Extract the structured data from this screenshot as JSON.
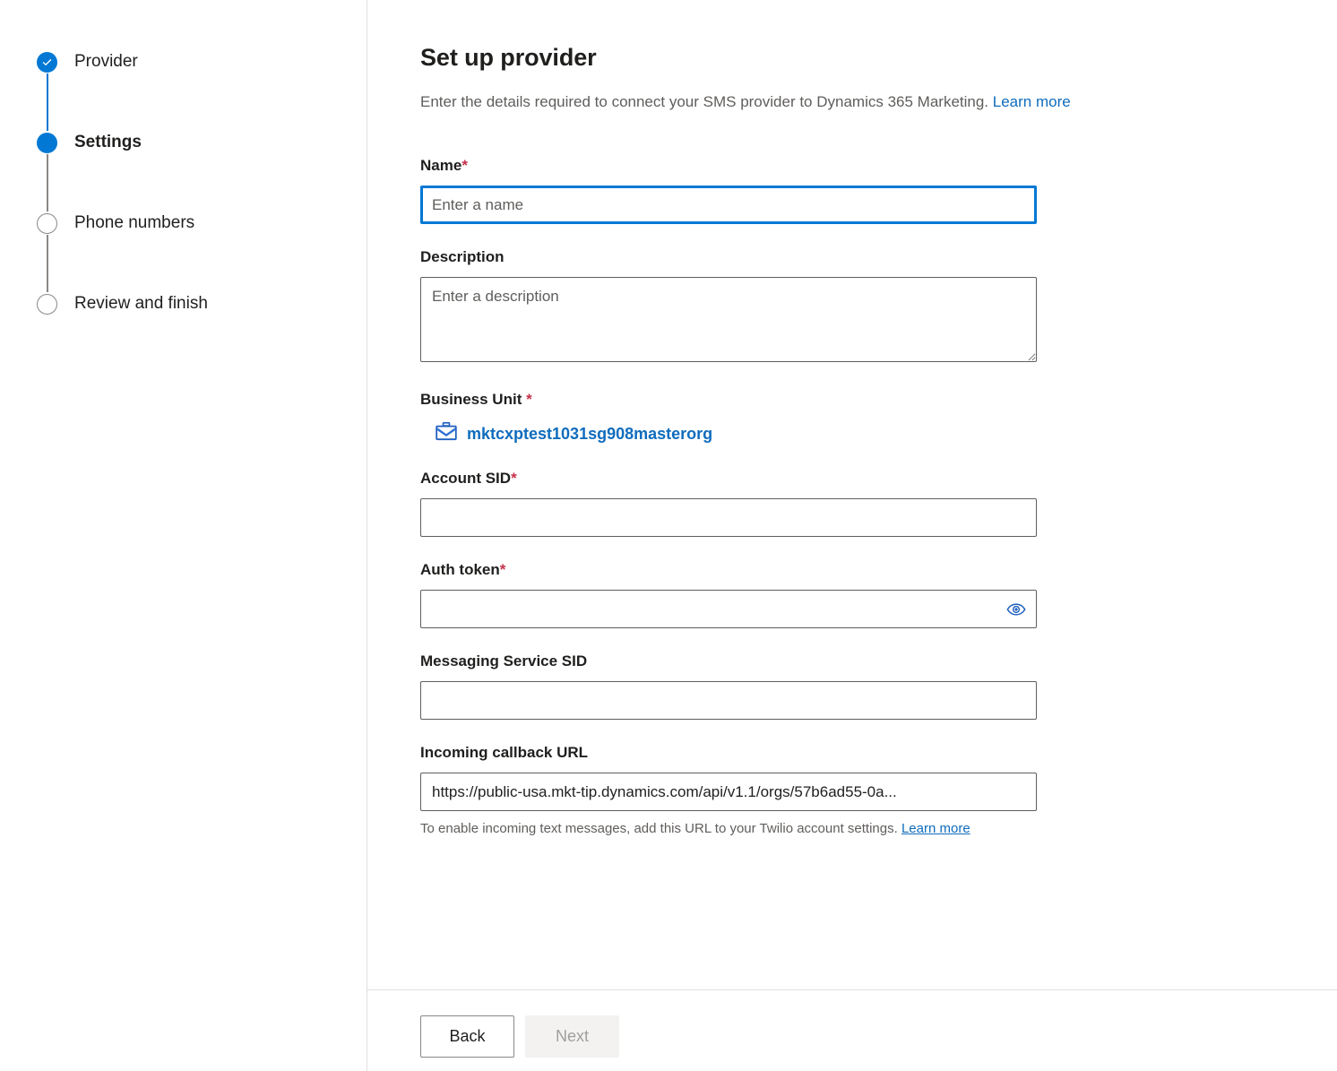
{
  "wizard": {
    "steps": [
      {
        "label": "Provider",
        "state": "done",
        "marker_icon": "check-icon"
      },
      {
        "label": "Settings",
        "state": "current",
        "marker_icon": "filled-circle-icon"
      },
      {
        "label": "Phone numbers",
        "state": "todo",
        "marker_icon": "empty-circle-icon"
      },
      {
        "label": "Review and finish",
        "state": "todo",
        "marker_icon": "empty-circle-icon"
      }
    ]
  },
  "header": {
    "title": "Set up provider",
    "subtitle": "Enter the details required to connect your SMS provider to Dynamics 365 Marketing.",
    "learn_more": "Learn more"
  },
  "form": {
    "name": {
      "label": "Name",
      "required_marker": "*",
      "placeholder": "Enter a name",
      "value": "",
      "focused": true
    },
    "description": {
      "label": "Description",
      "placeholder": "Enter a description",
      "value": ""
    },
    "business_unit": {
      "label": "Business Unit ",
      "required_marker": "*",
      "value": "mktcxptest1031sg908masterorg",
      "icon": "briefcase-icon"
    },
    "account_sid": {
      "label": "Account SID",
      "required_marker": "*",
      "placeholder": "",
      "value": ""
    },
    "auth_token": {
      "label": "Auth token",
      "required_marker": "*",
      "placeholder": "",
      "value": "",
      "reveal_icon": "eye-icon"
    },
    "messaging_service_sid": {
      "label": "Messaging Service SID",
      "placeholder": "",
      "value": ""
    },
    "incoming_callback_url": {
      "label": "Incoming callback URL",
      "value": "https://public-usa.mkt-tip.dynamics.com/api/v1.1/orgs/57b6ad55-0a...",
      "help_text": "To enable incoming text messages, add this URL to your Twilio account settings. ",
      "help_link": "Learn more"
    }
  },
  "footer": {
    "back_label": "Back",
    "next_label": "Next",
    "next_disabled": true
  },
  "colors": {
    "accent": "#0078d4",
    "link": "#0f6cbd",
    "required": "#c4314b",
    "border": "#605e5c",
    "divider": "#e1dfdd",
    "muted_text": "#605e5c",
    "disabled_bg": "#f3f2f1",
    "disabled_text": "#a19f9d"
  }
}
